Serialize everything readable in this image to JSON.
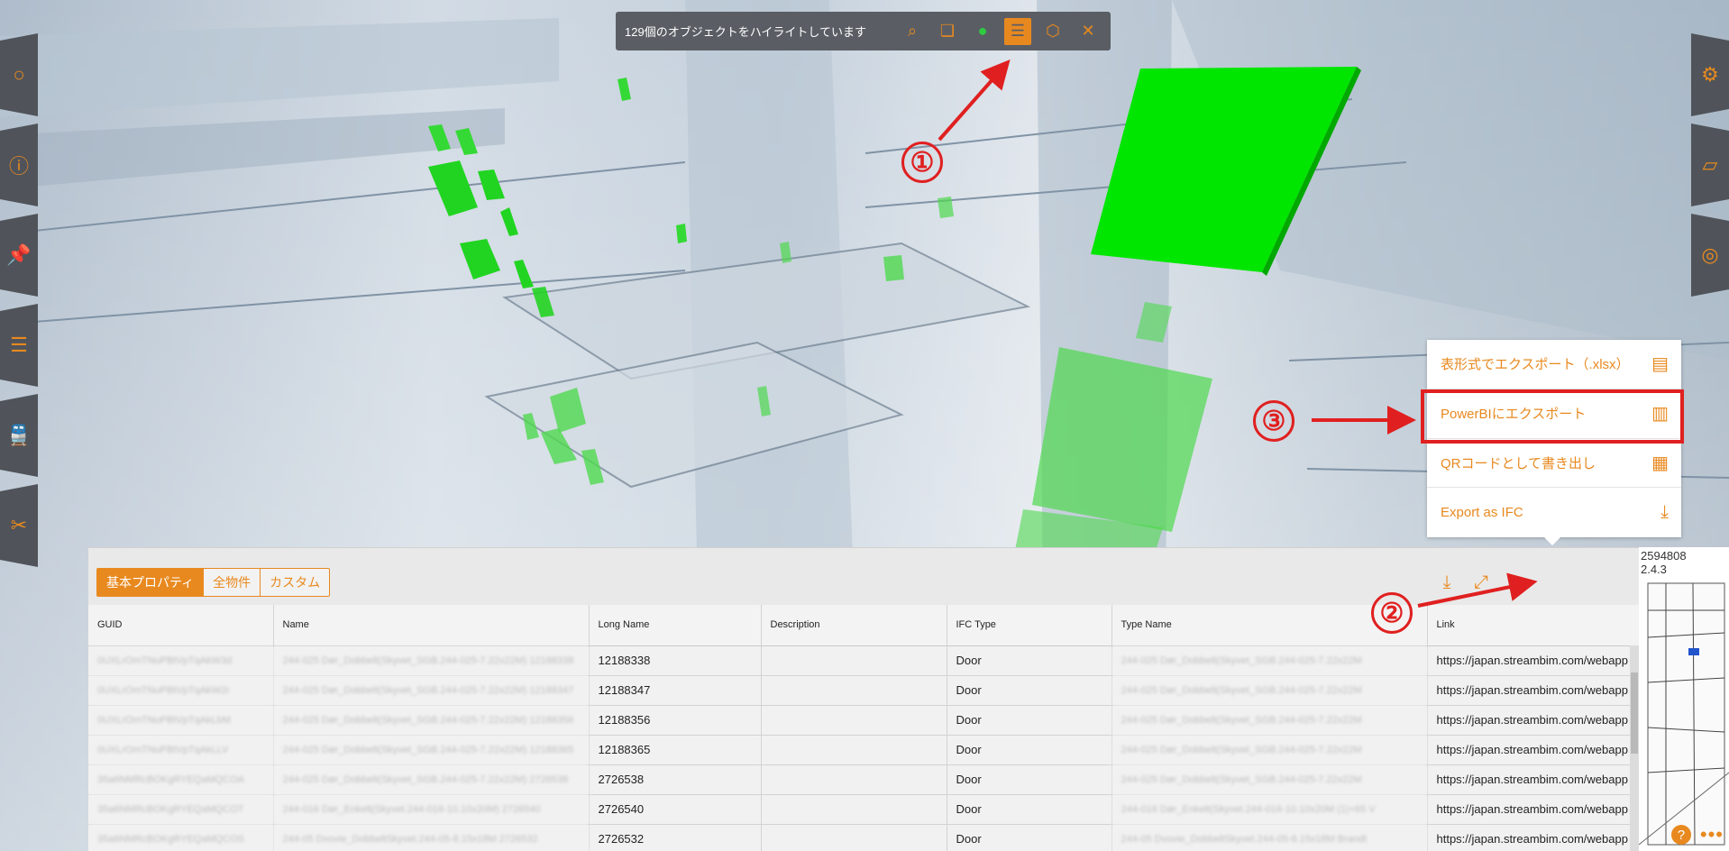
{
  "toolbar": {
    "message": "129個のオブジェクトをハイライトしています",
    "buttons": [
      {
        "icon": "zoom-to-selection-icon"
      },
      {
        "icon": "layers-icon"
      },
      {
        "icon": "color-icon"
      },
      {
        "icon": "list-icon",
        "active": true
      },
      {
        "icon": "tag-icon"
      },
      {
        "icon": "close-icon"
      }
    ]
  },
  "left_tools": [
    "circle-icon",
    "info-icon",
    "pin-icon",
    "list-icon",
    "train-icon",
    "measure-icon"
  ],
  "right_tools": [
    "gear-icon",
    "tag-icon",
    "visibility-icon"
  ],
  "export_menu": {
    "items": [
      {
        "label": "表形式でエクスポート（.xlsx）",
        "icon": "spreadsheet-icon"
      },
      {
        "label": "PowerBIにエクスポート",
        "icon": "powerbi-icon"
      },
      {
        "label": "QRコードとして書き出し",
        "icon": "qr-code-icon"
      },
      {
        "label": "Export as IFC",
        "icon": "download-icon"
      }
    ]
  },
  "annotations": {
    "one": "①",
    "two": "②",
    "three": "③"
  },
  "panel": {
    "tabs": [
      "基本プロパティ",
      "全物件",
      "カスタム"
    ],
    "columns": [
      "GUID",
      "Name",
      "Long Name",
      "Description",
      "IFC Type",
      "Type Name",
      "Link"
    ],
    "rows": [
      {
        "guid": "0UXLrOmTNuPBtVpTqAkW3d",
        "name": "244-025 Dør_Dobbelt(Skyvet_SGB.244-025-7.22x22M) 12188338",
        "long_name": "12188338",
        "description": "",
        "ifc_type": "Door",
        "type_name": "244-025 Dør_Dobbelt(Skyvet_SGB.244-025-7.22x22M",
        "link": "https://japan.streambim.com/webapp"
      },
      {
        "guid": "0UXLrOmTNuPBtVpTqAkW2r",
        "name": "244-025 Dør_Dobbelt(Skyvet_SGB.244-025-7.22x22M) 12188347",
        "long_name": "12188347",
        "description": "",
        "ifc_type": "Door",
        "type_name": "244-025 Dør_Dobbelt(Skyvet_SGB.244-025-7.22x22M",
        "link": "https://japan.streambim.com/webapp"
      },
      {
        "guid": "0UXLrOmTNuPBtVpTqAkLbM",
        "name": "244-025 Dør_Dobbelt(Skyvet_SGB.244-025-7.22x22M) 12188356",
        "long_name": "12188356",
        "description": "",
        "ifc_type": "Door",
        "type_name": "244-025 Dør_Dobbelt(Skyvet_SGB.244-025-7.22x22M",
        "link": "https://japan.streambim.com/webapp"
      },
      {
        "guid": "0UXLrOmTNuPBtVpTqAkLLV",
        "name": "244-025 Dør_Dobbelt(Skyvet_SGB.244-025-7.22x22M) 12188365",
        "long_name": "12188365",
        "description": "",
        "ifc_type": "Door",
        "type_name": "244-025 Dør_Dobbelt(Skyvet_SGB.244-025-7.22x22M",
        "link": "https://japan.streambim.com/webapp"
      },
      {
        "guid": "35a6NMRcBOKgRYEQaMQCOA",
        "name": "244-025 Dør_Dobbelt(Skyvet_SGB.244-025-7.22x22M) 2726538",
        "long_name": "2726538",
        "description": "",
        "ifc_type": "Door",
        "type_name": "244-025 Dør_Dobbelt(Skyvet_SGB.244-025-7.22x22M",
        "link": "https://japan.streambim.com/webapp"
      },
      {
        "guid": "35a6NMRcBOKgRYEQaMQCOT",
        "name": "244-016 Dør_Enkelt(Skyvet.244-016-10.10x20M) 2726540",
        "long_name": "2726540",
        "description": "",
        "ifc_type": "Door",
        "type_name": "244-016 Dør_Enkelt(Skyvet.244-016-10.10x20M (1)+65 V",
        "link": "https://japan.streambim.com/webapp"
      },
      {
        "guid": "35a6NMRcBOKgRYEQaMQCOS",
        "name": "244-05 Dvovie_DobbeltSkyvet.244-05-8.15x18M 2726532",
        "long_name": "2726532",
        "description": "",
        "ifc_type": "Door",
        "type_name": "244-05 Dvovie_DobbeltSkyvet.244-05-8.15x18M Brandt",
        "link": "https://japan.streambim.com/webapp"
      }
    ]
  },
  "minimap": {
    "coord_line1": "2594808",
    "coord_line2": "2.4.3"
  },
  "help_label": "?",
  "more_label": "•••",
  "colors": {
    "accent": "#e8891f",
    "highlight_green": "#00e600",
    "annotation_red": "#e02020",
    "toolbar_bg": "#5a5e64"
  }
}
